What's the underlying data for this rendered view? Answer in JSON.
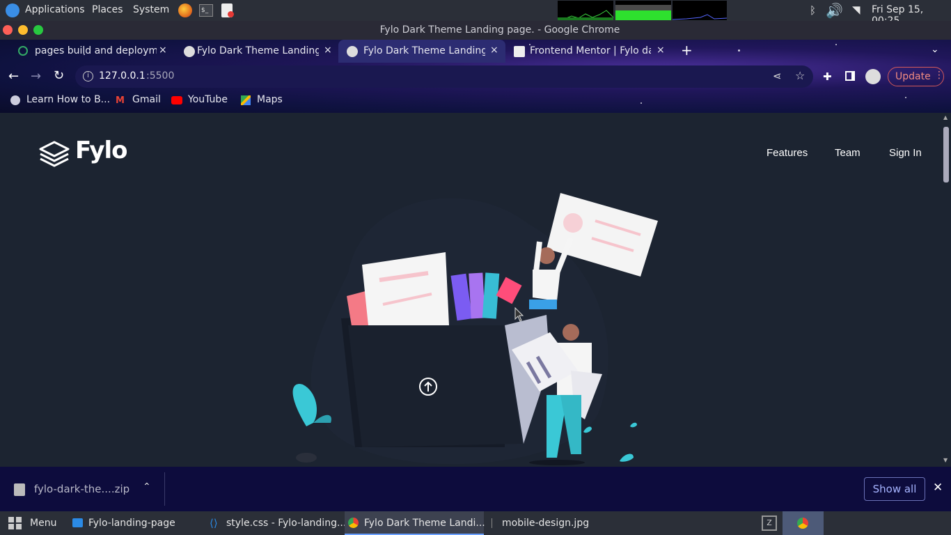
{
  "system_panel": {
    "applications": "Applications",
    "places": "Places",
    "system": "System",
    "clock": "Fri Sep 15, 00:25"
  },
  "window": {
    "title": "Fylo Dark Theme Landing page. - Google Chrome"
  },
  "tabs": [
    {
      "label": "pages build and deployme",
      "close": "×"
    },
    {
      "label": "Fylo Dark Theme Landing",
      "close": "×"
    },
    {
      "label": "Fylo Dark Theme Landing",
      "close": "×"
    },
    {
      "label": "Frontend Mentor | Fylo da",
      "close": "×"
    }
  ],
  "new_tab": "+",
  "omnibox": {
    "host": "127.0.0.1",
    "port": ":5500"
  },
  "update_button": "Update",
  "bookmarks": [
    "Learn How to B...",
    "Gmail",
    "YouTube",
    "Maps"
  ],
  "site": {
    "logo": "Fylo",
    "nav": [
      "Features",
      "Team",
      "Sign In"
    ]
  },
  "download_bar": {
    "file": "fylo-dark-the....zip",
    "show_all": "Show all"
  },
  "taskbar": {
    "menu": "Menu",
    "items": [
      "Fylo-landing-page",
      "style.css - Fylo-landing...",
      "Fylo Dark Theme Landi...",
      "mobile-design.jpg"
    ]
  },
  "colors": {
    "page_bg": "#1c2431",
    "accent_cyan": "#3ac8d6",
    "accent_pink": "#ff6f91",
    "update_red": "#f28b82"
  }
}
